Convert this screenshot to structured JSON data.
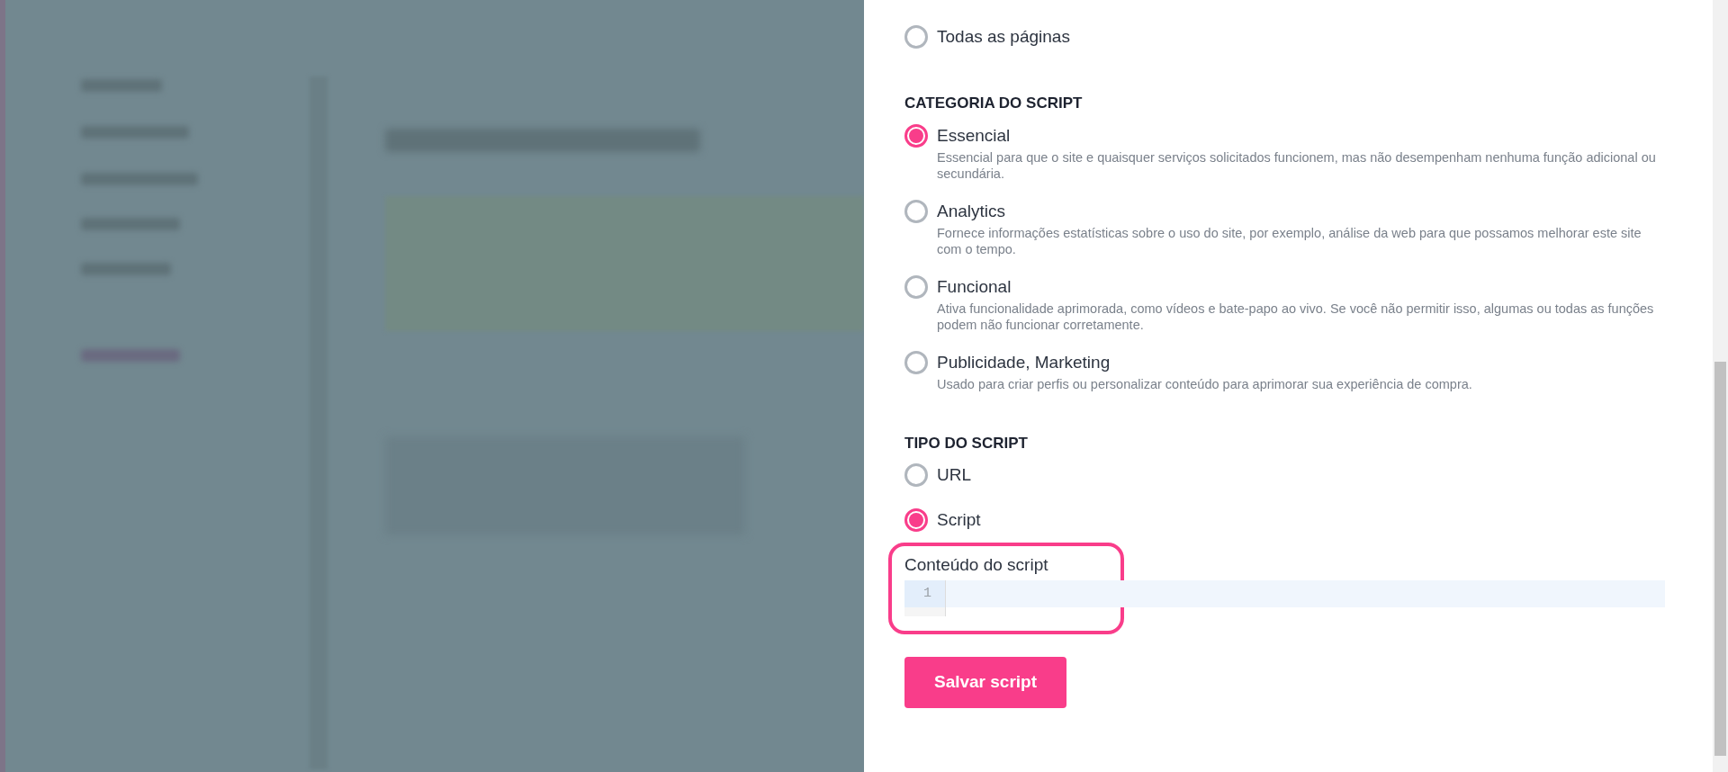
{
  "drawer": {
    "pages_option": {
      "label": "Todas as páginas",
      "selected": false
    },
    "category": {
      "heading": "CATEGORIA DO SCRIPT",
      "options": [
        {
          "label": "Essencial",
          "description": "Essencial para que o site e quaisquer serviços solicitados funcionem, mas não desempenham nenhuma função adicional ou secundária.",
          "selected": true
        },
        {
          "label": "Analytics",
          "description": "Fornece informações estatísticas sobre o uso do site, por exemplo, análise da web para que possamos melhorar este site com o tempo.",
          "selected": false
        },
        {
          "label": "Funcional",
          "description": "Ativa funcionalidade aprimorada, como vídeos e bate-papo ao vivo. Se você não permitir isso, algumas ou todas as funções podem não funcionar corretamente.",
          "selected": false
        },
        {
          "label": "Publicidade, Marketing",
          "description": "Usado para criar perfis ou personalizar conteúdo para aprimorar sua experiência de compra.",
          "selected": false
        }
      ]
    },
    "type": {
      "heading": "TIPO DO SCRIPT",
      "options": [
        {
          "label": "URL",
          "selected": false
        },
        {
          "label": "Script",
          "selected": true
        }
      ]
    },
    "editor": {
      "label": "Conteúdo do script",
      "line_numbers": [
        "1"
      ],
      "highlighted": true
    },
    "save_button": "Salvar script"
  }
}
